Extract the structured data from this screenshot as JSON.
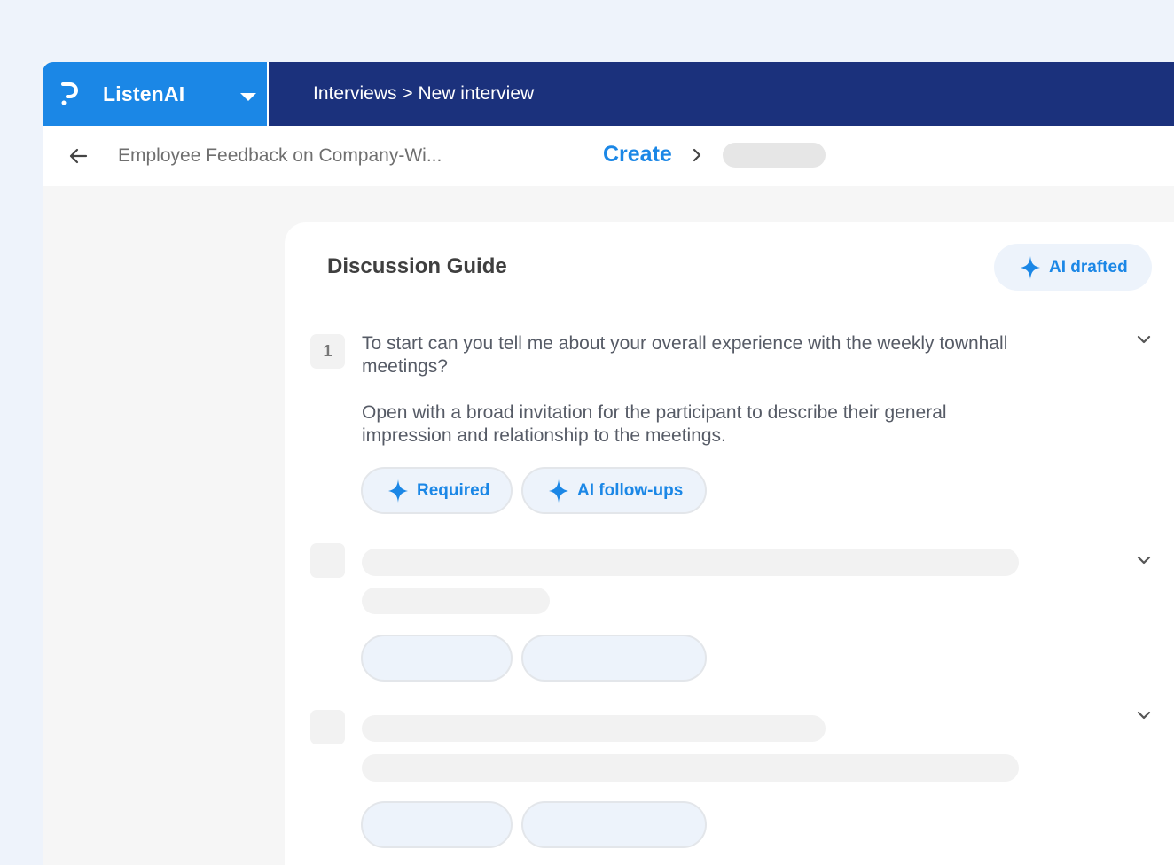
{
  "brand": {
    "name": "ListenAI",
    "logo_icon": "p-logo-icon",
    "caret_icon": "caret-down-icon"
  },
  "nav": {
    "breadcrumb": "Interviews > New interview"
  },
  "subheader": {
    "title": "Employee Feedback on Company-Wi...",
    "step_current": "Create"
  },
  "guide": {
    "title": "Discussion Guide",
    "ai_drafted_label": "AI drafted",
    "questions": [
      {
        "number": "1",
        "text": "To start can you tell  me about your overall experience with the weekly townhall meetings?",
        "description": "Open with a broad invitation for the participant to describe their general impression and relationship to the meetings.",
        "tags": [
          "Required",
          "AI follow-ups"
        ]
      }
    ]
  },
  "colors": {
    "brand_blue": "#1b87e6",
    "nav_navy": "#1b317c",
    "pill_bg": "#edf3fb",
    "skeleton": "#f2f2f2"
  }
}
